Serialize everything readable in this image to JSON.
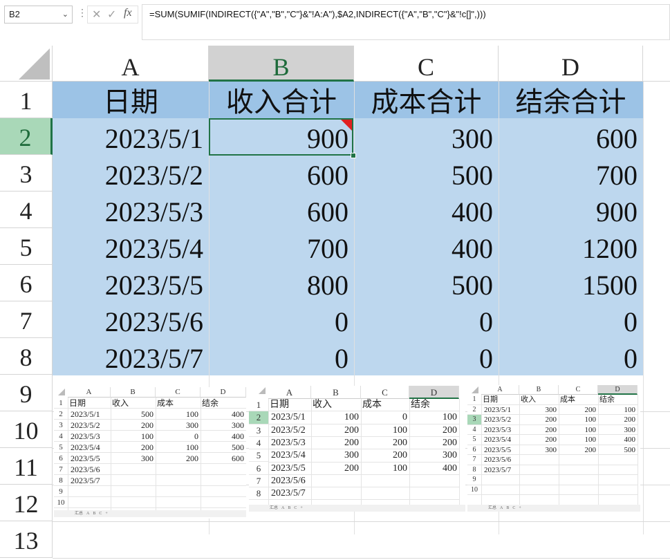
{
  "formula_bar": {
    "name_box": "B2",
    "formula": "=SUM(SUMIF(INDIRECT({\"A\",\"B\",\"C\"}&\"!A:A\"),$A2,INDIRECT({\"A\",\"B\",\"C\"}&\"!c[]\",)))",
    "fx_label": "fx"
  },
  "sheet": {
    "columns": [
      "A",
      "B",
      "C",
      "D"
    ],
    "selected_column": "B",
    "rows": [
      "1",
      "2",
      "3",
      "4",
      "5",
      "6",
      "7",
      "8",
      "9",
      "10",
      "11",
      "12",
      "13"
    ],
    "selected_row": "2",
    "header": [
      "日期",
      "收入合计",
      "成本合计",
      "结余合计"
    ],
    "data": [
      [
        "2023/5/1",
        "900",
        "300",
        "600"
      ],
      [
        "2023/5/2",
        "600",
        "500",
        "700"
      ],
      [
        "2023/5/3",
        "600",
        "400",
        "900"
      ],
      [
        "2023/5/4",
        "700",
        "400",
        "1200"
      ],
      [
        "2023/5/5",
        "800",
        "500",
        "1500"
      ],
      [
        "2023/5/6",
        "0",
        "0",
        "0"
      ],
      [
        "2023/5/7",
        "0",
        "0",
        "0"
      ]
    ],
    "colors": {
      "table_header_bg": "#9cc3e6",
      "table_body_bg": "#bdd7ee",
      "selection": "#217346",
      "comment_mark": "#e02020"
    }
  },
  "thumbnails": [
    {
      "columns": [
        "A",
        "B",
        "C",
        "D"
      ],
      "header": [
        "日期",
        "收入",
        "成本",
        "结余"
      ],
      "rows": [
        [
          "2023/5/1",
          "500",
          "100",
          "400"
        ],
        [
          "2023/5/2",
          "200",
          "300",
          "300"
        ],
        [
          "2023/5/3",
          "100",
          "0",
          "400"
        ],
        [
          "2023/5/4",
          "200",
          "100",
          "500"
        ],
        [
          "2023/5/5",
          "300",
          "200",
          "600"
        ],
        [
          "2023/5/6",
          "",
          "",
          ""
        ],
        [
          "2023/5/7",
          "",
          "",
          ""
        ]
      ],
      "row_numbers": [
        "1",
        "2",
        "3",
        "4",
        "5",
        "6",
        "7",
        "8",
        "9",
        "10"
      ],
      "tabs": [
        "汇总",
        "A",
        "B",
        "C",
        "+"
      ]
    },
    {
      "columns": [
        "A",
        "B",
        "C",
        "D"
      ],
      "header": [
        "日期",
        "收入",
        "成本",
        "结余"
      ],
      "rows": [
        [
          "2023/5/1",
          "100",
          "0",
          "100"
        ],
        [
          "2023/5/2",
          "200",
          "100",
          "200"
        ],
        [
          "2023/5/3",
          "200",
          "200",
          "200"
        ],
        [
          "2023/5/4",
          "300",
          "200",
          "300"
        ],
        [
          "2023/5/5",
          "200",
          "100",
          "400"
        ],
        [
          "2023/5/6",
          "",
          "",
          ""
        ],
        [
          "2023/5/7",
          "",
          "",
          ""
        ]
      ],
      "row_numbers": [
        "1",
        "2",
        "3",
        "4",
        "5",
        "6",
        "7",
        "8",
        "9"
      ],
      "tabs": [
        "汇总",
        "A",
        "B",
        "C",
        "+"
      ]
    },
    {
      "columns": [
        "A",
        "B",
        "C",
        "D"
      ],
      "header": [
        "日期",
        "收入",
        "成本",
        "结余"
      ],
      "rows": [
        [
          "2023/5/1",
          "300",
          "200",
          "100"
        ],
        [
          "2023/5/2",
          "200",
          "100",
          "200"
        ],
        [
          "2023/5/3",
          "200",
          "100",
          "300"
        ],
        [
          "2023/5/4",
          "200",
          "100",
          "400"
        ],
        [
          "2023/5/5",
          "300",
          "200",
          "500"
        ],
        [
          "2023/5/6",
          "",
          "",
          ""
        ],
        [
          "2023/5/7",
          "",
          "",
          ""
        ]
      ],
      "row_numbers": [
        "1",
        "2",
        "3",
        "4",
        "5",
        "6",
        "7",
        "8",
        "9",
        "10",
        "11"
      ],
      "tabs": [
        "汇总",
        "A",
        "B",
        "C",
        "+"
      ]
    }
  ]
}
